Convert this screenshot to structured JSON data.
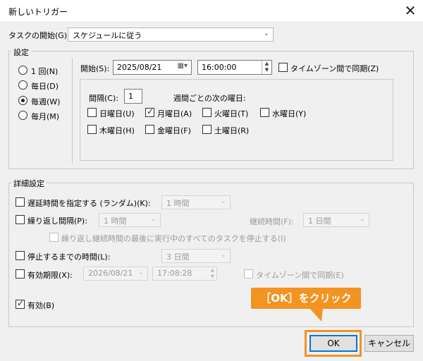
{
  "window": {
    "title": "新しいトリガー",
    "close": "✕"
  },
  "begin_task": {
    "label": "タスクの開始(G):",
    "value": "スケジュールに従う"
  },
  "settings": {
    "group_label": "設定",
    "radios": [
      {
        "label": "1 回(N)",
        "selected": false
      },
      {
        "label": "毎日(D)",
        "selected": false
      },
      {
        "label": "毎週(W)",
        "selected": true
      },
      {
        "label": "毎月(M)",
        "selected": false
      }
    ],
    "start_label": "開始(S):",
    "start_date": "2025/08/21",
    "start_time": "16:00:00",
    "sync_tz_label": "タイムゾーン間で同期(Z)",
    "interval_label": "間隔(C):",
    "interval_value": "1",
    "weekday_label": "週間ごとの次の曜日:",
    "weekdays": [
      {
        "label": "日曜日(U)",
        "checked": false
      },
      {
        "label": "月曜日(A)",
        "checked": true
      },
      {
        "label": "火曜日(T)",
        "checked": false
      },
      {
        "label": "水曜日(Y)",
        "checked": false
      },
      {
        "label": "木曜日(H)",
        "checked": false
      },
      {
        "label": "金曜日(F)",
        "checked": false
      },
      {
        "label": "土曜日(R)",
        "checked": false
      }
    ]
  },
  "advanced": {
    "group_label": "詳細設定",
    "delay_label": "遅延時間を指定する (ランダム)(K):",
    "delay_value": "1 時間",
    "repeat_label": "繰り返し間隔(P):",
    "repeat_value": "1 時間",
    "duration_label": "継続時間(F):",
    "duration_value": "1 日間",
    "stop_all_label": "繰り返し継続時間の最後に実行中のすべてのタスクを停止する(I)",
    "stop_after_label": "停止するまでの時間(L):",
    "stop_after_value": "3 日間",
    "expire_label": "有効期限(X):",
    "expire_date": "2026/08/21",
    "expire_time": "17:08:28",
    "expire_sync_label": "タイムゾーン間で同期(E)",
    "enabled_label": "有効(B)"
  },
  "buttons": {
    "ok": "OK",
    "cancel": "キャンセル"
  },
  "callout": {
    "text": "［OK］をクリック"
  },
  "colors": {
    "accent": "#f39321",
    "focus": "#0078d7"
  }
}
